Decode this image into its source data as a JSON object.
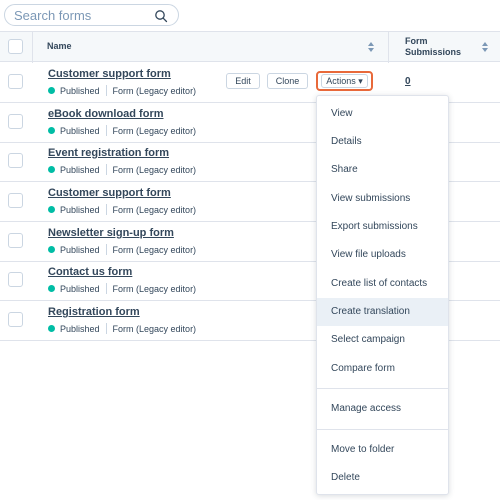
{
  "search": {
    "placeholder": "Search forms"
  },
  "table": {
    "headers": {
      "name": "Name",
      "submissions_line1": "Form",
      "submissions_line2": "Submissions"
    }
  },
  "rows": [
    {
      "title": "Customer support form",
      "status": "Published",
      "type": "Form (Legacy editor)"
    },
    {
      "title": "eBook download form",
      "status": "Published",
      "type": "Form (Legacy editor)"
    },
    {
      "title": "Event registration form",
      "status": "Published",
      "type": "Form (Legacy editor)"
    },
    {
      "title": "Customer support form",
      "status": "Published",
      "type": "Form (Legacy editor)"
    },
    {
      "title": "Newsletter sign-up form",
      "status": "Published",
      "type": "Form (Legacy editor)"
    },
    {
      "title": "Contact us form",
      "status": "Published",
      "type": "Form (Legacy editor)"
    },
    {
      "title": "Registration form",
      "status": "Published",
      "type": "Form (Legacy editor)"
    }
  ],
  "row_actions": {
    "edit": "Edit",
    "clone": "Clone",
    "actions": "Actions ▾",
    "submissions_count": "0"
  },
  "menu": {
    "items": [
      "View",
      "Details",
      "Share",
      "View submissions",
      "Export submissions",
      "View file uploads",
      "Create list of contacts",
      "Create translation",
      "Select campaign",
      "Compare form",
      "Manage access",
      "Move to folder",
      "Delete"
    ],
    "highlighted": "Create translation"
  },
  "colors": {
    "published_dot": "#00bda5",
    "actions_highlight": "#e8693a",
    "text": "#33475b"
  }
}
